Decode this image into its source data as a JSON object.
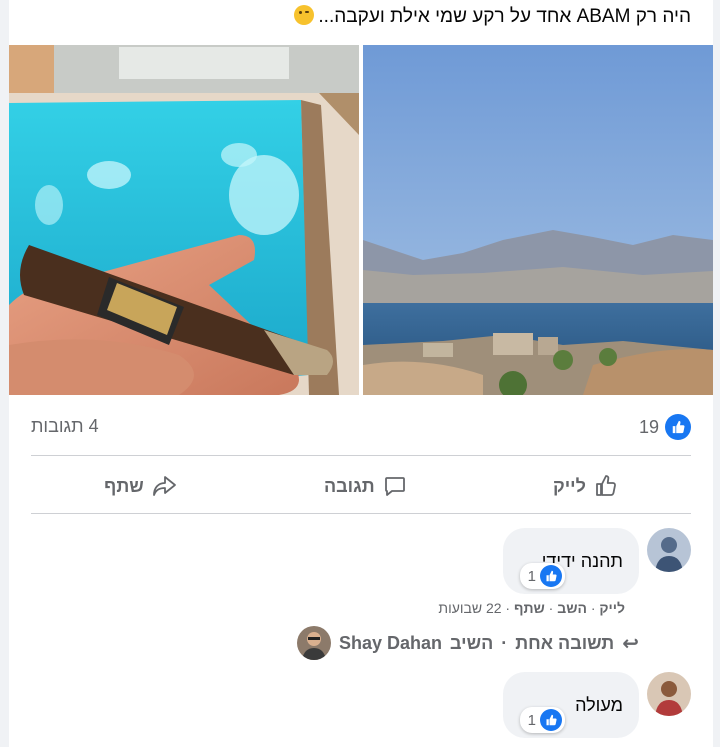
{
  "post": {
    "caption": "היה רק ABAM אחד על רקע שמי אילת ועקבה...",
    "emoji_icon": "winking-face-emoji"
  },
  "photos": {
    "left_description_icon": "pool-cigar-photo",
    "right_description_icon": "eilat-bay-photo"
  },
  "stats": {
    "likes": "19",
    "comments": "4 תגובות"
  },
  "actions": {
    "like": "לייק",
    "comment": "תגובה",
    "share": "שתף"
  },
  "comments": [
    {
      "text": "תהנה ידידי",
      "reactions": "1",
      "meta_like": "לייק",
      "meta_reply": "השב",
      "meta_share": "שתף",
      "meta_time": "22 שבועות",
      "reply_author": "Shay Dahan",
      "reply_prefix": "השיב",
      "reply_count": "תשובה אחת"
    },
    {
      "text": "מעולה",
      "reactions": "1"
    }
  ],
  "colors": {
    "accent": "#1877f2",
    "muted": "#65676b",
    "bubble": "#f0f2f5"
  }
}
